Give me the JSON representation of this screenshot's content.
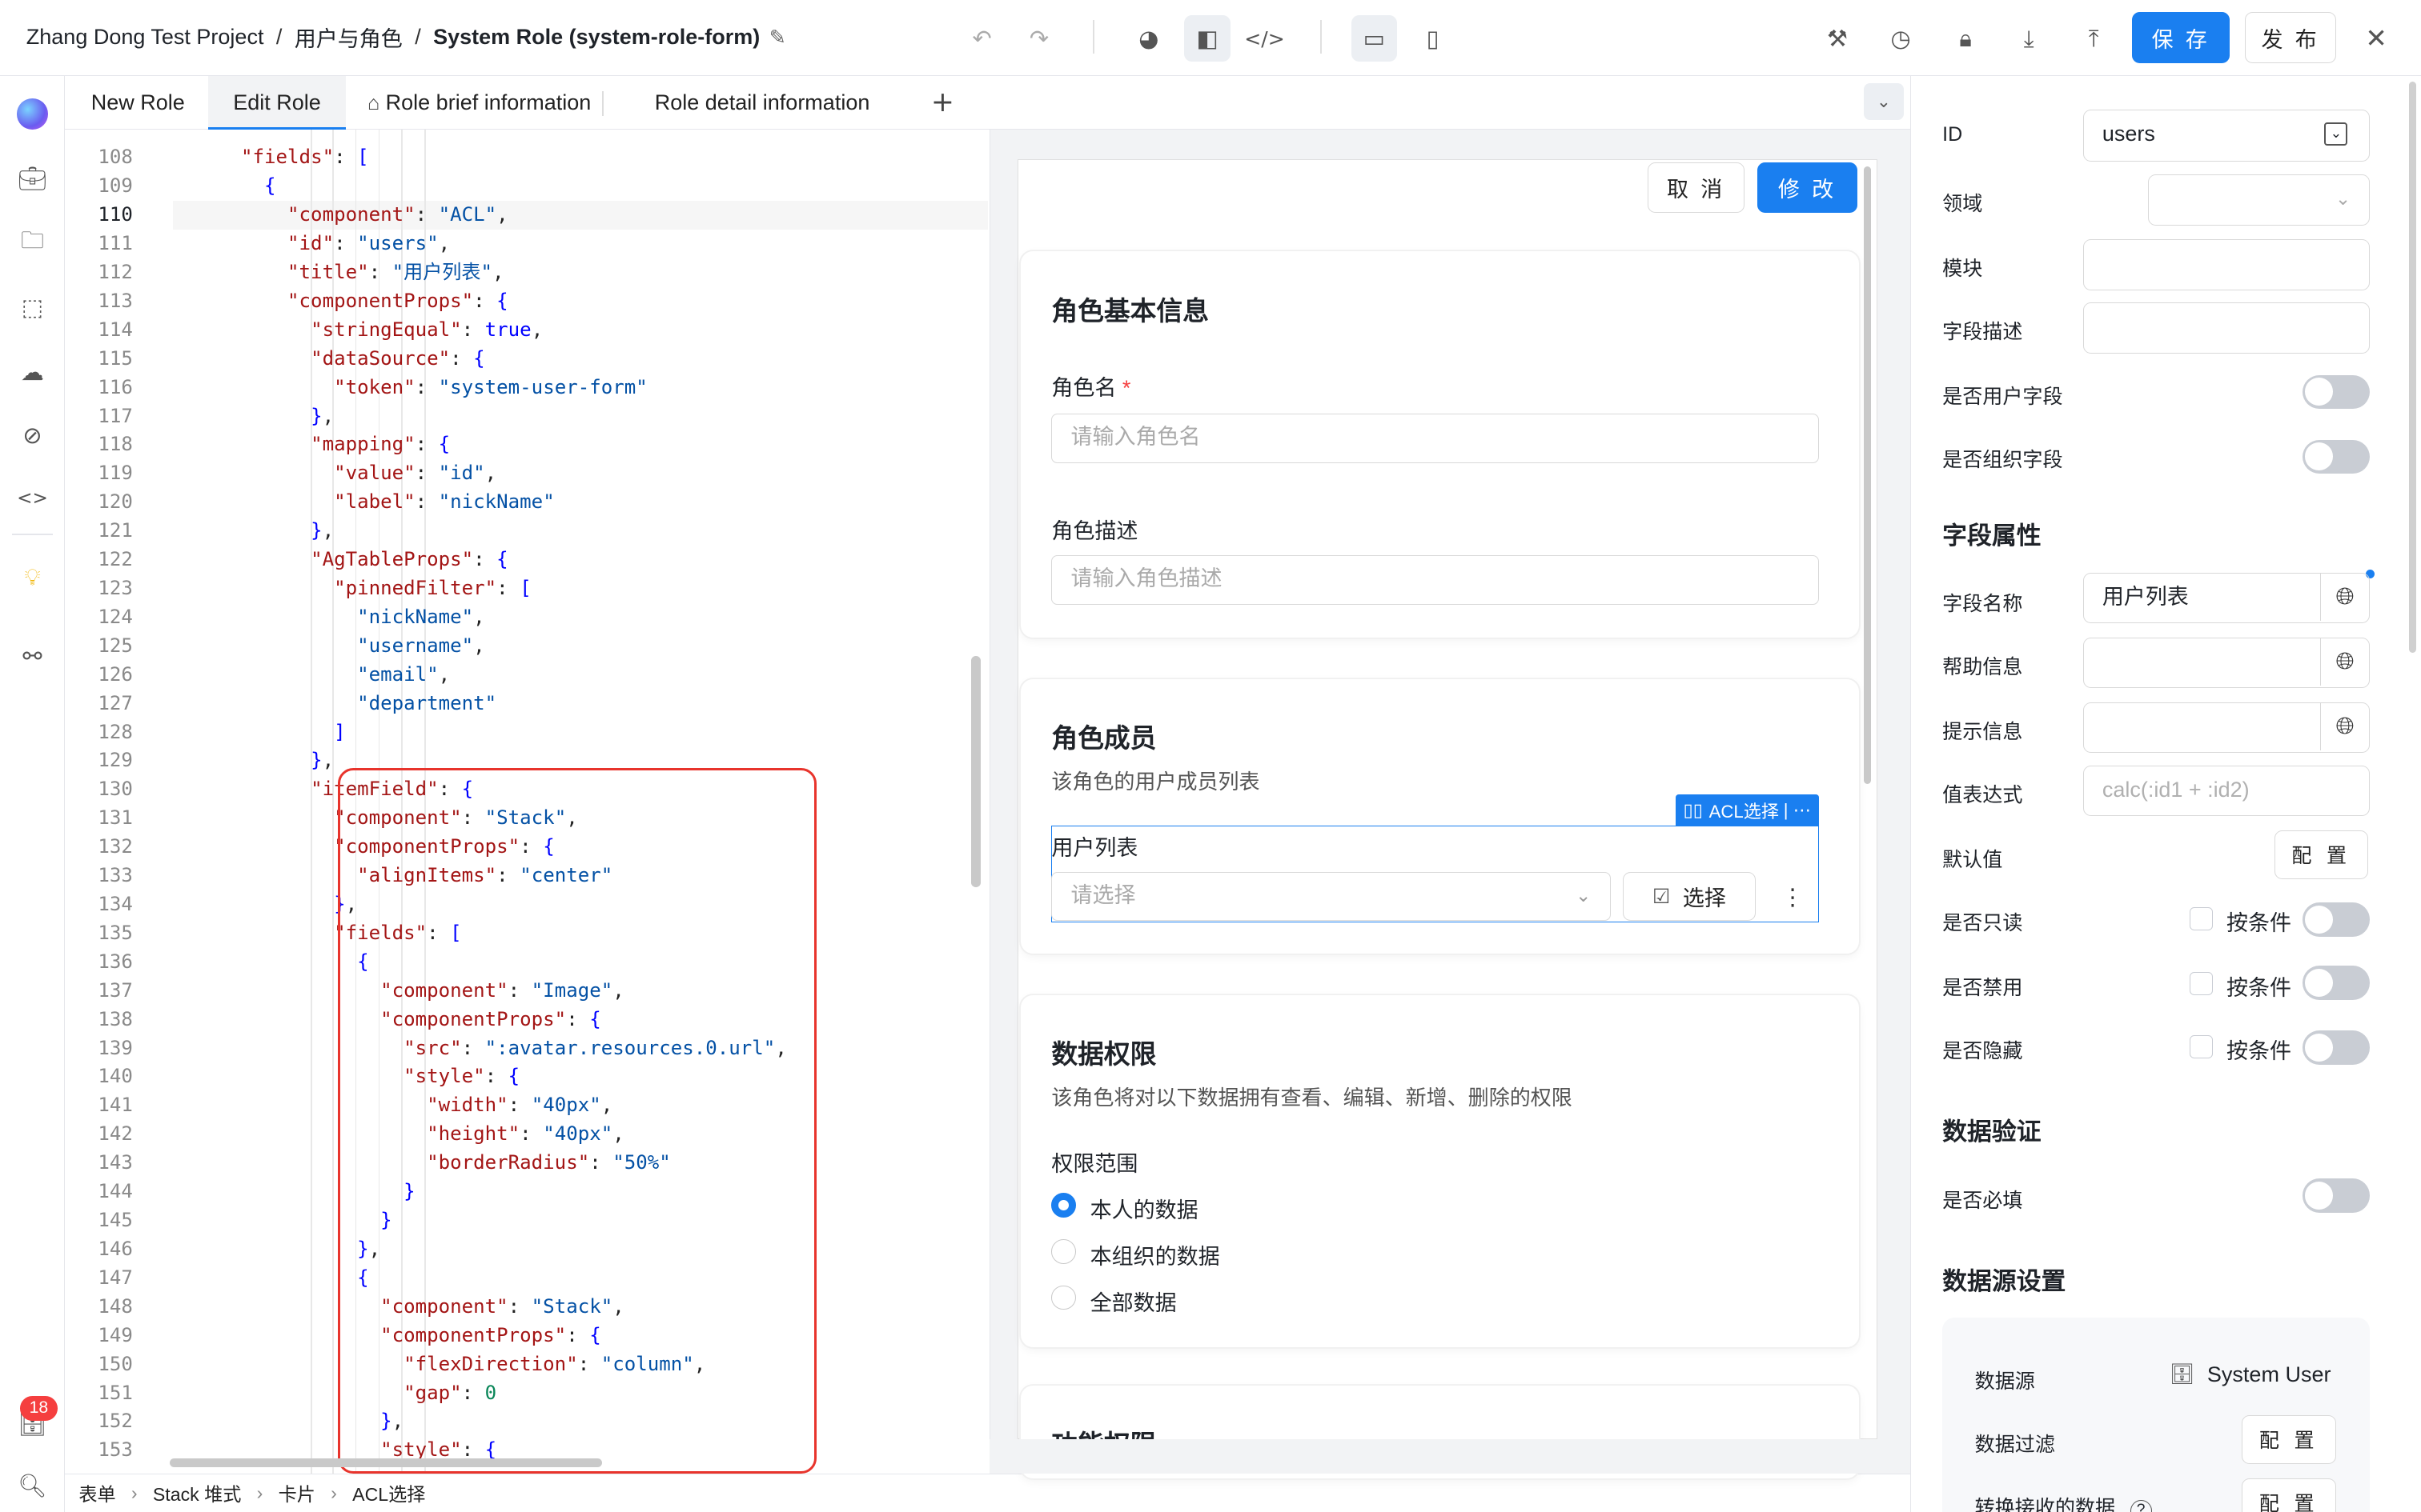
{
  "breadcrumb": [
    "Zhang Dong Test Project",
    "用户与角色",
    "System Role (system-role-form)"
  ],
  "topbar": {
    "save": "保 存",
    "publish": "发 布"
  },
  "tabs": [
    "New Role",
    "Edit Role",
    "Role brief information",
    "Role detail information"
  ],
  "add_tab": "+",
  "editor": {
    "current_line": 110,
    "lines": [
      {
        "n": 108,
        "html": "    <span class='k'>\"fields\"</span><span class='p'>: </span><span class='b'>[</span>"
      },
      {
        "n": 109,
        "html": "      <span class='b'>{</span>"
      },
      {
        "n": 110,
        "html": "        <span class='k'>\"component\"</span>: <span class='s'>\"ACL\"</span>,"
      },
      {
        "n": 111,
        "html": "        <span class='k'>\"id\"</span>: <span class='s'>\"users\"</span>,"
      },
      {
        "n": 112,
        "html": "        <span class='k'>\"title\"</span>: <span class='s'>\"用户列表\"</span>,"
      },
      {
        "n": 113,
        "html": "        <span class='k'>\"componentProps\"</span>: <span class='b'>{</span>"
      },
      {
        "n": 114,
        "html": "          <span class='k'>\"stringEqual\"</span>: <span class='b'>true</span>,"
      },
      {
        "n": 115,
        "html": "          <span class='k'>\"dataSource\"</span>: <span class='b'>{</span>"
      },
      {
        "n": 116,
        "html": "            <span class='k'>\"token\"</span>: <span class='s'>\"system-user-form\"</span>"
      },
      {
        "n": 117,
        "html": "          <span class='b'>}</span>,"
      },
      {
        "n": 118,
        "html": "          <span class='k'>\"mapping\"</span>: <span class='b'>{</span>"
      },
      {
        "n": 119,
        "html": "            <span class='k'>\"value\"</span>: <span class='s'>\"id\"</span>,"
      },
      {
        "n": 120,
        "html": "            <span class='k'>\"label\"</span>: <span class='s'>\"nickName\"</span>"
      },
      {
        "n": 121,
        "html": "          <span class='b'>}</span>,"
      },
      {
        "n": 122,
        "html": "          <span class='k'>\"AgTableProps\"</span>: <span class='b'>{</span>"
      },
      {
        "n": 123,
        "html": "            <span class='k'>\"pinnedFilter\"</span>: <span class='b'>[</span>"
      },
      {
        "n": 124,
        "html": "              <span class='s'>\"nickName\"</span>,"
      },
      {
        "n": 125,
        "html": "              <span class='s'>\"username\"</span>,"
      },
      {
        "n": 126,
        "html": "              <span class='s'>\"email\"</span>,"
      },
      {
        "n": 127,
        "html": "              <span class='s'>\"department\"</span>"
      },
      {
        "n": 128,
        "html": "            <span class='b'>]</span>"
      },
      {
        "n": 129,
        "html": "          <span class='b'>}</span>,"
      },
      {
        "n": 130,
        "html": "          <span class='k'>\"itemField\"</span>: <span class='b'>{</span>"
      },
      {
        "n": 131,
        "html": "            <span class='k'>\"component\"</span>: <span class='s'>\"Stack\"</span>,"
      },
      {
        "n": 132,
        "html": "            <span class='k'>\"componentProps\"</span>: <span class='b'>{</span>"
      },
      {
        "n": 133,
        "html": "              <span class='k'>\"alignItems\"</span>: <span class='s'>\"center\"</span>"
      },
      {
        "n": 134,
        "html": "            <span class='b'>}</span>,"
      },
      {
        "n": 135,
        "html": "            <span class='k'>\"fields\"</span>: <span class='b'>[</span>"
      },
      {
        "n": 136,
        "html": "              <span class='b'>{</span>"
      },
      {
        "n": 137,
        "html": "                <span class='k'>\"component\"</span>: <span class='s'>\"Image\"</span>,"
      },
      {
        "n": 138,
        "html": "                <span class='k'>\"componentProps\"</span>: <span class='b'>{</span>"
      },
      {
        "n": 139,
        "html": "                  <span class='k'>\"src\"</span>: <span class='s'>\":avatar.resources.0.url\"</span>,"
      },
      {
        "n": 140,
        "html": "                  <span class='k'>\"style\"</span>: <span class='b'>{</span>"
      },
      {
        "n": 141,
        "html": "                    <span class='k'>\"width\"</span>: <span class='s'>\"40px\"</span>,"
      },
      {
        "n": 142,
        "html": "                    <span class='k'>\"height\"</span>: <span class='s'>\"40px\"</span>,"
      },
      {
        "n": 143,
        "html": "                    <span class='k'>\"borderRadius\"</span>: <span class='s'>\"50%\"</span>"
      },
      {
        "n": 144,
        "html": "                  <span class='b'>}</span>"
      },
      {
        "n": 145,
        "html": "                <span class='b'>}</span>"
      },
      {
        "n": 146,
        "html": "              <span class='b'>}</span>,"
      },
      {
        "n": 147,
        "html": "              <span class='b'>{</span>"
      },
      {
        "n": 148,
        "html": "                <span class='k'>\"component\"</span>: <span class='s'>\"Stack\"</span>,"
      },
      {
        "n": 149,
        "html": "                <span class='k'>\"componentProps\"</span>: <span class='b'>{</span>"
      },
      {
        "n": 150,
        "html": "                  <span class='k'>\"flexDirection\"</span>: <span class='s'>\"column\"</span>,"
      },
      {
        "n": 151,
        "html": "                  <span class='k'>\"gap\"</span>: <span class='n'>0</span>"
      },
      {
        "n": 152,
        "html": "                <span class='b'>}</span>,"
      },
      {
        "n": 153,
        "html": "                <span class='k'>\"style\"</span>: <span class='b'>{</span>"
      }
    ]
  },
  "statusbar": [
    "表单",
    "Stack 堆式",
    "卡片",
    "ACL选择"
  ],
  "preview": {
    "cancel": "取 消",
    "modify": "修 改",
    "basic_title": "角色基本信息",
    "role_name_label": "角色名",
    "role_name_ph": "请输入角色名",
    "role_desc_label": "角色描述",
    "role_desc_ph": "请输入角色描述",
    "members_title": "角色成员",
    "members_desc": "该角色的用户成员列表",
    "acl_tag": "ACL选择",
    "acl_tag_more": "| ⋯",
    "user_list_label": "用户列表",
    "select_ph": "请选择",
    "select_btn": "选择",
    "perm_title": "数据权限",
    "perm_desc": "该角色将对以下数据拥有查看、编辑、新增、删除的权限",
    "scope_label": "权限范围",
    "scope_options": [
      "本人的数据",
      "本组织的数据",
      "全部数据"
    ],
    "func_title": "功能权限"
  },
  "right": {
    "id_label": "ID",
    "id_value": "users",
    "domain_label": "领域",
    "module_label": "模块",
    "field_desc_label": "字段描述",
    "is_user_field": "是否用户字段",
    "is_org_field": "是否组织字段",
    "props_title": "字段属性",
    "field_name_label": "字段名称",
    "field_name_value": "用户列表",
    "help_label": "帮助信息",
    "hint_label": "提示信息",
    "value_expr_label": "值表达式",
    "value_expr_ph": "calc(:id1 + :id2)",
    "default_label": "默认值",
    "config": "配 置",
    "readonly_label": "是否只读",
    "disabled_label": "是否禁用",
    "hidden_label": "是否隐藏",
    "by_condition": "按条件",
    "validation_title": "数据验证",
    "required_label": "是否必填",
    "ds_title": "数据源设置",
    "ds_label": "数据源",
    "ds_value": "System User",
    "filter_label": "数据过滤",
    "transform_label": "转换接收的数据",
    "help_mark": "?"
  },
  "left_badge": "18",
  "accent": "#1a7ff0"
}
